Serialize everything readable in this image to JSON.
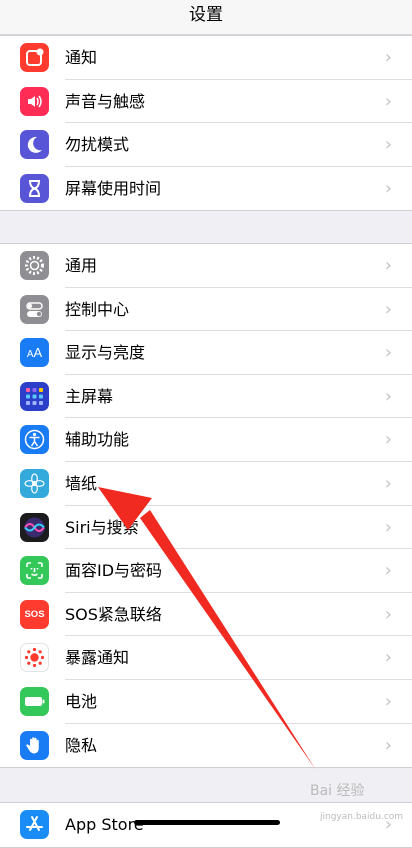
{
  "header": {
    "title": "设置"
  },
  "groups": [
    {
      "rows": [
        {
          "label": "通知",
          "icon": "notifications-icon",
          "color": "#ff3b30"
        },
        {
          "label": "声音与触感",
          "icon": "sounds-icon",
          "color": "#ff2d55"
        },
        {
          "label": "勿扰模式",
          "icon": "moon-icon",
          "color": "#5856d6"
        },
        {
          "label": "屏幕使用时间",
          "icon": "hourglass-icon",
          "color": "#5856d6"
        }
      ]
    },
    {
      "rows": [
        {
          "label": "通用",
          "icon": "gear-icon",
          "color": "#8e8e93"
        },
        {
          "label": "控制中心",
          "icon": "toggles-icon",
          "color": "#8e8e93"
        },
        {
          "label": "显示与亮度",
          "icon": "text-size-icon",
          "color": "#1a7cf5"
        },
        {
          "label": "主屏幕",
          "icon": "home-grid-icon",
          "color": "#2c3fc8"
        },
        {
          "label": "辅助功能",
          "icon": "accessibility-icon",
          "color": "#1a7cf5"
        },
        {
          "label": "墙纸",
          "icon": "wallpaper-flower-icon",
          "color": "#34aadc"
        },
        {
          "label": "Siri与搜索",
          "icon": "siri-icon",
          "color": "#1c1c1e"
        },
        {
          "label": "面容ID与密码",
          "icon": "face-id-icon",
          "color": "#34c759"
        },
        {
          "label": "SOS紧急联络",
          "icon": "sos-icon",
          "color": "#ff3b30"
        },
        {
          "label": "暴露通知",
          "icon": "exposure-icon",
          "color": "#ffffff"
        },
        {
          "label": "电池",
          "icon": "battery-icon",
          "color": "#34c759"
        },
        {
          "label": "隐私",
          "icon": "hand-icon",
          "color": "#1a7cf5"
        }
      ]
    },
    {
      "rows": [
        {
          "label": "App Store",
          "icon": "app-store-icon",
          "color": "#1a8cf5"
        }
      ]
    }
  ],
  "sos_icon_text": "SOS",
  "watermark": {
    "text": "Bai 经验",
    "sub": "jingyan.baidu.com"
  }
}
